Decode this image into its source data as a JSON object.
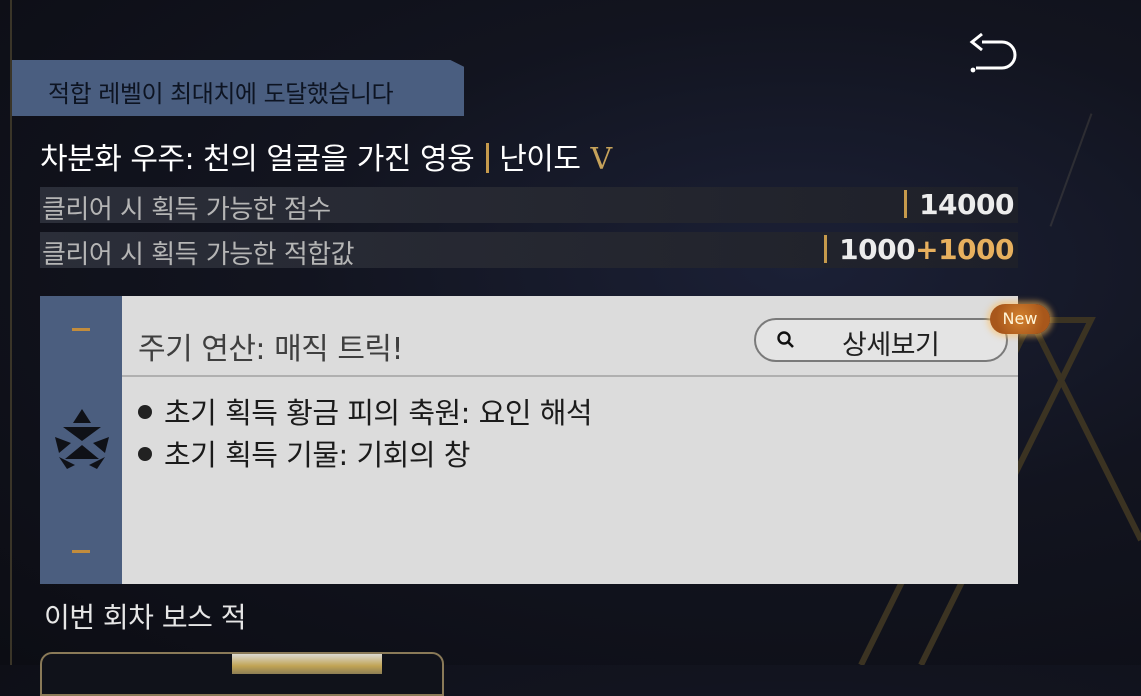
{
  "header": {
    "banner_text": "적합 레벨이 최대치에 도달했습니다",
    "back_icon": "return-arrow-icon"
  },
  "title": {
    "name": "차분화 우주: 천의 얼굴을 가진 영웅",
    "difficulty_label": "난이도",
    "difficulty_value": "V"
  },
  "stats": [
    {
      "label": "클리어 시 획득 가능한 점수",
      "value": "14000",
      "bonus": ""
    },
    {
      "label": "클리어 시 획득 가능한 적합값",
      "value": "1000",
      "bonus": "+1000"
    }
  ],
  "event_card": {
    "title": "주기 연산: 매직 트릭!",
    "detail_button": "상세보기",
    "badge": "New",
    "bullets": [
      "초기 획득 황금 피의 축원: 요인 해석",
      "초기 획득 기물: 기회의 창"
    ]
  },
  "boss_section": {
    "label": "이번 회차 보스 적"
  },
  "colors": {
    "accent_gold": "#c69a4c",
    "banner_blue": "#4a5e80",
    "bonus_orange": "#e7b05e",
    "badge_orange": "#c2702a"
  }
}
